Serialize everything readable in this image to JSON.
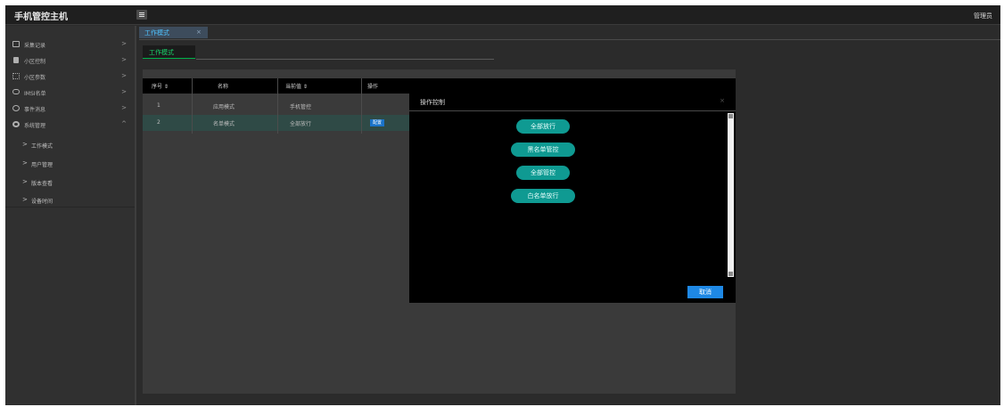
{
  "app": {
    "title": "手机管控主机",
    "user": "管理员"
  },
  "sidebar": {
    "items": [
      {
        "label": "采集记录",
        "caret": ">",
        "icon": "calendar-icon"
      },
      {
        "label": "小区控制",
        "caret": ">",
        "icon": "square-icon"
      },
      {
        "label": "小区参数",
        "caret": ">",
        "icon": "grid-icon"
      },
      {
        "label": "IMSI名单",
        "caret": ">",
        "icon": "list-icon"
      },
      {
        "label": "事件消息",
        "caret": ">",
        "icon": "message-icon"
      },
      {
        "label": "系统管理",
        "caret": "^",
        "icon": "gear-icon"
      }
    ],
    "sub_items": [
      {
        "label": "工作模式",
        "arrow": ">"
      },
      {
        "label": "用户管理",
        "arrow": ">"
      },
      {
        "label": "版本查看",
        "arrow": ">"
      },
      {
        "label": "设备时间",
        "arrow": ">"
      }
    ]
  },
  "tabs": {
    "main": "工作模式",
    "main_close": "×",
    "sub": "工作模式"
  },
  "table": {
    "headers": [
      "序号 ⇕",
      "名称",
      "当前值 ⇕",
      "操作"
    ],
    "rows": [
      {
        "index": "1",
        "name": "应用模式",
        "value": "手机管控",
        "action": ""
      },
      {
        "index": "2",
        "name": "名单模式",
        "value": "全部放行",
        "action": "配置"
      }
    ]
  },
  "modal": {
    "title": "操作控制",
    "close": "×",
    "buttons": [
      "全部放行",
      "黑名单管控",
      "全部管控",
      "白名单放行"
    ],
    "cancel": "取消"
  },
  "colors": {
    "accent": "#0f9a92",
    "primary": "#1e88e5",
    "active_tab_text": "#19d36b"
  }
}
